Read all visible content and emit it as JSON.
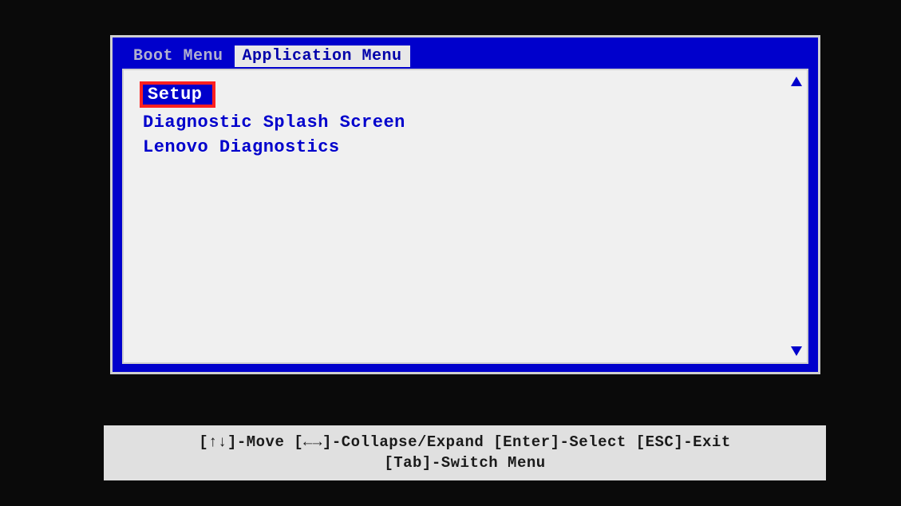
{
  "tabs": {
    "boot": "Boot Menu",
    "application": "Application Menu"
  },
  "menu": {
    "items": [
      {
        "label": "Setup",
        "selected": true
      },
      {
        "label": "Diagnostic Splash Screen",
        "selected": false
      },
      {
        "label": "Lenovo Diagnostics",
        "selected": false
      }
    ]
  },
  "help": {
    "line1": "[↑↓]-Move [←→]-Collapse/Expand [Enter]-Select [ESC]-Exit",
    "line2": "[Tab]-Switch Menu"
  }
}
